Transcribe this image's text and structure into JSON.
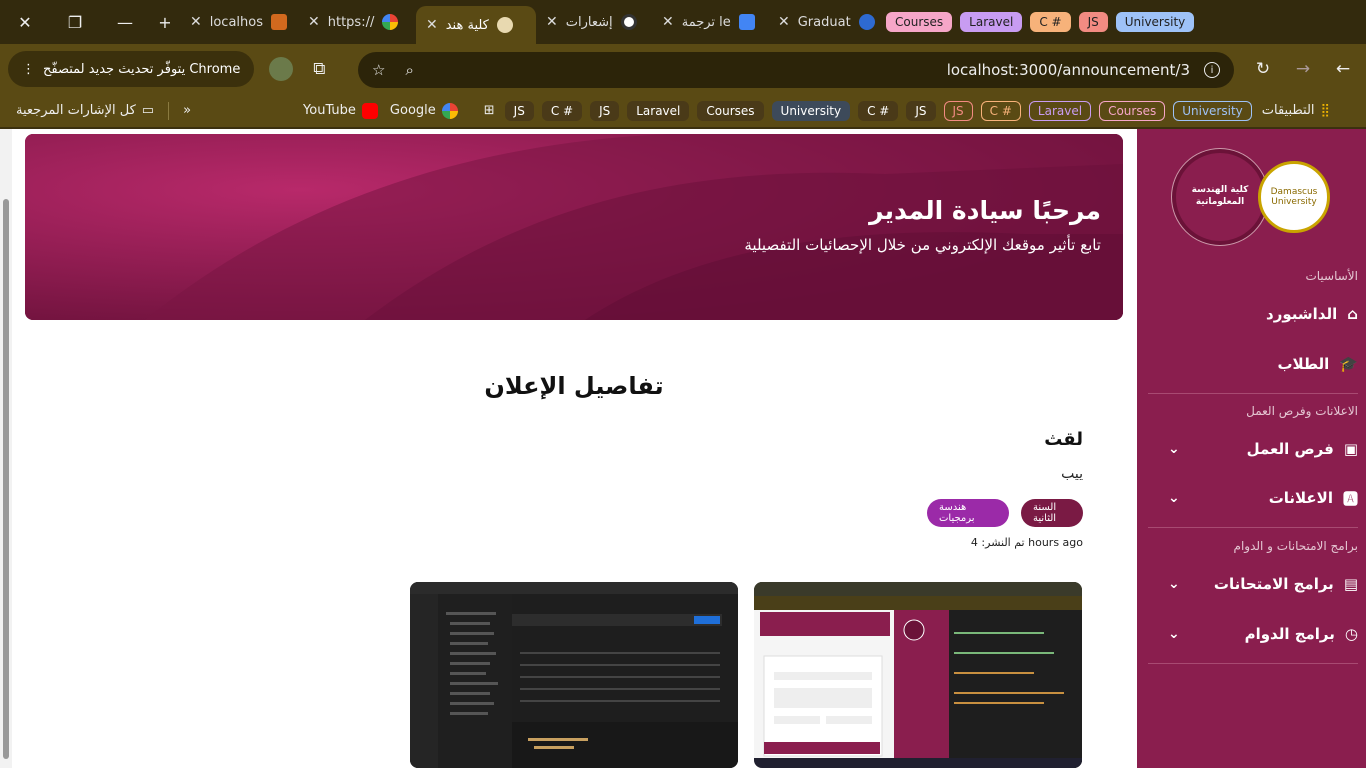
{
  "tabs": [
    {
      "title": "localhos",
      "active": false
    },
    {
      "title": "https://",
      "active": false
    },
    {
      "title": "كلية هند",
      "active": true
    },
    {
      "title": "إشعارات",
      "active": false
    },
    {
      "title": "ترجمة le",
      "active": false
    },
    {
      "title": "Graduat",
      "active": false
    }
  ],
  "tab_pills": [
    "Courses",
    "Laravel",
    "C #",
    "JS",
    "University"
  ],
  "toolbar": {
    "update_label": "يتوفّر تحديث جديد لمتصفّح Chrome",
    "url": "localhost:3000/announcement/3"
  },
  "bookmarks": {
    "all_label": "كل الإشارات المرجعية",
    "youtube": "YouTube",
    "google": "Google",
    "pills": [
      "JS",
      "C #",
      "JS",
      "Laravel",
      "Courses",
      "University",
      "C #",
      "JS",
      "JS",
      "C #",
      "Laravel",
      "Courses",
      "University"
    ],
    "apps_label": "التطبيقات"
  },
  "sidebar": {
    "logo_text": "كلية الهندسة المعلوماتية",
    "logo_b_text": "Damascus University",
    "sections": {
      "basics": "الأساسيات",
      "ads_jobs": "الاعلانات وفرص العمل",
      "exams": "برامج الامتحانات و الدوام"
    },
    "items": {
      "dashboard": "الداشبورد",
      "students": "الطلاب",
      "jobs": "فرص العمل",
      "announcements": "الاعلانات",
      "exam_programs": "برامج الامتحانات",
      "work_programs": "برامج الدوام"
    }
  },
  "hero": {
    "title": "مرحبًا سيادة المدير",
    "subtitle": "تابع تأثير موقعك الإلكتروني من خلال الإحصائيات التفصيلية"
  },
  "announcement": {
    "page_title": "تفاصيل الإعلان",
    "title": "لقث",
    "body": "ييب",
    "badges": [
      "السنة الثانية",
      "هندسة برمجيات"
    ],
    "posted_label": "تم النشر:",
    "posted_value": "4 hours ago"
  },
  "colors": {
    "primary": "#8a1e4e",
    "badge_year": "#7a1a44",
    "badge_dept": "#9b2aa8"
  }
}
